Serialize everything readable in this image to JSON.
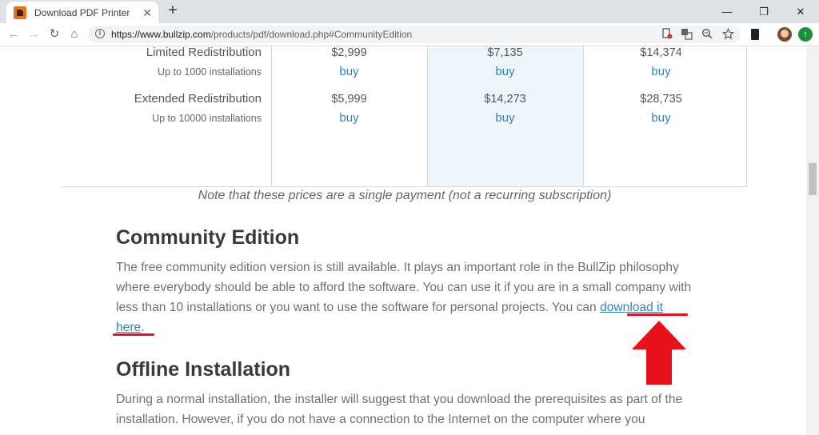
{
  "browser": {
    "tab_title": "Download PDF Printer",
    "tab_close": "✕",
    "new_tab": "+",
    "url_host": "https://www.bullzip.com",
    "url_path": "/products/pdf/download.php#CommunityEdition",
    "window_controls": {
      "minimize": "—",
      "restore": "❐",
      "close": "✕"
    },
    "nav": {
      "back": "←",
      "forward": "→",
      "reload": "↻",
      "home": "⌂"
    }
  },
  "pricing": {
    "cut_buy_labels": [
      "buy",
      "buy"
    ],
    "rows": [
      {
        "name": "Limited Redistribution",
        "sub": "Up to 1000 installations",
        "prices": [
          "$2,999",
          "$7,135",
          "$14,374"
        ],
        "buy_label": "buy"
      },
      {
        "name": "Extended Redistribution",
        "sub": "Up to 10000 installations",
        "prices": [
          "$5,999",
          "$14,273",
          "$28,735"
        ],
        "buy_label": "buy"
      }
    ],
    "note": "Note that these prices are a single payment (not a recurring subscription)"
  },
  "community": {
    "heading": "Community Edition",
    "text": "The free community edition version is still available. It plays an important role in the BullZip philosophy where everybody should be able to afford the software. You can use it if you are in a small company with less than 10 installations or you want to use the software for personal projects. You can",
    "link_text": "download it here",
    "after_link": "."
  },
  "offline": {
    "heading": "Offline Installation",
    "text": "During a normal installation, the installer will suggest that you download the prerequisites as part of the installation. However, if you do not have a connection to the Internet on the computer where you"
  },
  "annotation": {
    "arrow_color": "#e8101a"
  }
}
